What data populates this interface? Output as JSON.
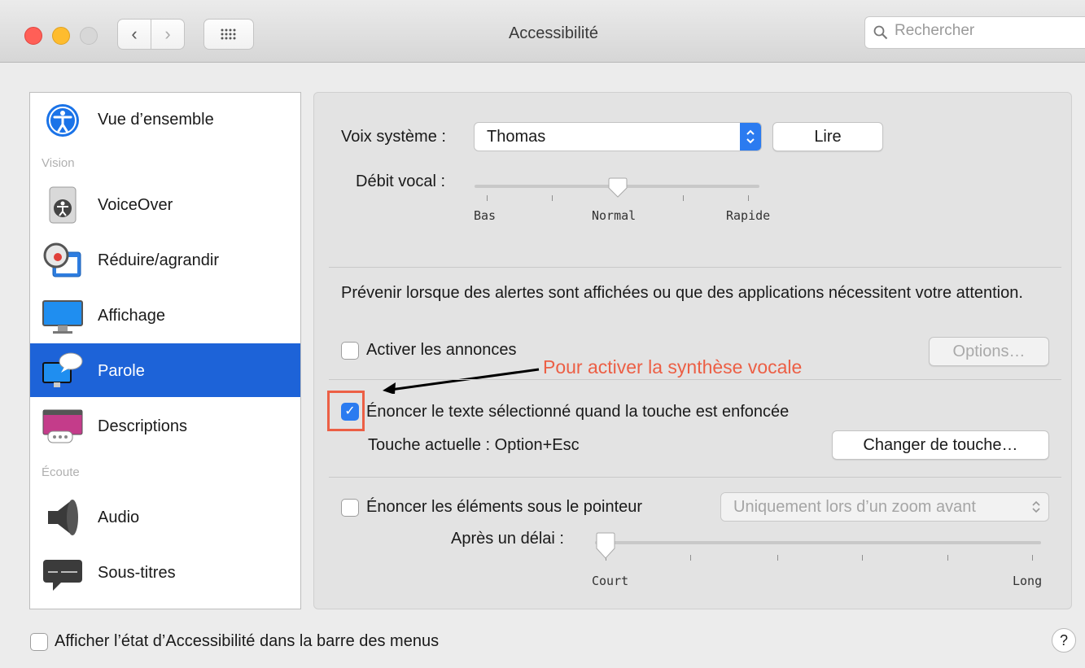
{
  "window": {
    "title": "Accessibilité"
  },
  "search": {
    "placeholder": "Rechercher"
  },
  "sidebar": {
    "items": [
      {
        "label": "Vue d’ensemble"
      },
      {
        "label": "VoiceOver"
      },
      {
        "label": "Réduire/agrandir"
      },
      {
        "label": "Affichage"
      },
      {
        "label": "Parole"
      },
      {
        "label": "Descriptions"
      },
      {
        "label": "Audio"
      },
      {
        "label": "Sous-titres"
      }
    ],
    "sections": {
      "vision": "Vision",
      "ecoute": "Écoute"
    },
    "selected": "Parole"
  },
  "voice": {
    "label": "Voix système :",
    "value": "Thomas",
    "play_button": "Lire",
    "rate_label": "Débit vocal :",
    "rate_ticks": [
      "Bas",
      "Normal",
      "Rapide"
    ],
    "rate_level": 0.5
  },
  "alerts": {
    "description": "Prévenir lorsque des alertes sont affichées ou que des applications nécessitent votre attention.",
    "checkbox_label": "Activer les annonces",
    "checked": false,
    "options_button": "Options…"
  },
  "annotation": {
    "text": "Pour activer la synthèse vocale",
    "color": "#ec5f45"
  },
  "speak_selected": {
    "checkbox_label": "Énoncer le texte sélectionné quand la touche est enfoncée",
    "checked": true,
    "current_key": "Touche actuelle : Option+Esc",
    "change_button": "Changer de touche…"
  },
  "speak_pointer": {
    "checkbox_label": "Énoncer les éléments sous le pointeur",
    "checked": false,
    "mode_select": "Uniquement lors d’un zoom avant",
    "delay_label": "Après un délai :",
    "delay_ticks": [
      "Court",
      "Long"
    ],
    "delay_level": 0.0
  },
  "footer": {
    "checkbox_label": "Afficher l’état d’Accessibilité dans la barre des menus",
    "checked": false,
    "help": "?"
  },
  "colors": {
    "selection": "#1d63d8",
    "checkbox_on": "#2b7bf0",
    "highlight_box": "#ec5f45"
  }
}
